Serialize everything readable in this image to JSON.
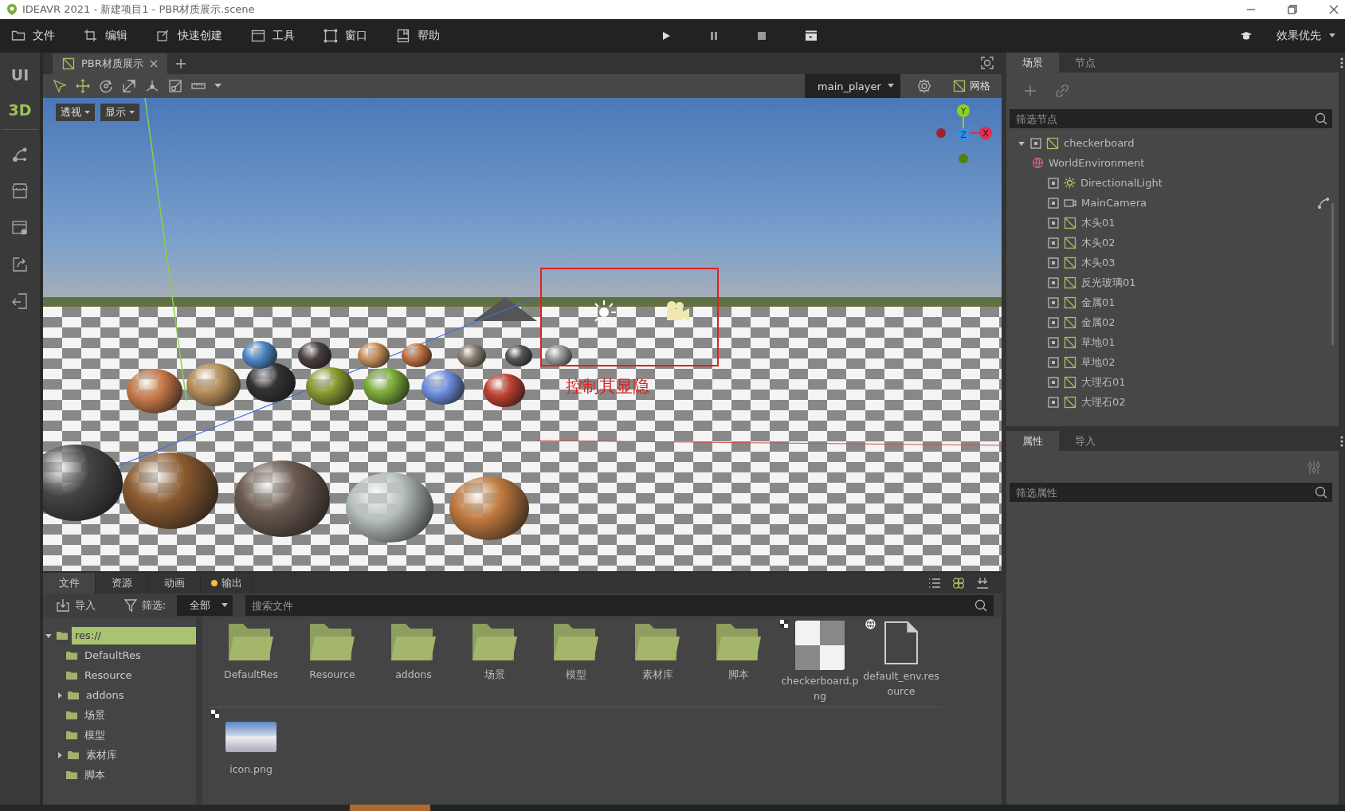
{
  "window": {
    "title": "IDEAVR 2021 - 新建项目1 - PBR材质展示.scene"
  },
  "menu": [
    {
      "label": "文件"
    },
    {
      "label": "编辑"
    },
    {
      "label": "快速创建"
    },
    {
      "label": "工具"
    },
    {
      "label": "窗口"
    },
    {
      "label": "帮助"
    }
  ],
  "quality": {
    "label": "效果优先"
  },
  "side_modes": [
    {
      "label": "UI",
      "selected": false
    },
    {
      "label": "3D",
      "selected": true
    }
  ],
  "editor_tabs": [
    {
      "label": "PBR材质展示",
      "selected": true
    }
  ],
  "viewport": {
    "camera": "main_player",
    "grid_label": "网格",
    "view_buttons": [
      "透视",
      "显示"
    ],
    "axes": {
      "y": "Y",
      "z": "Z",
      "x": "X"
    },
    "annotation": "控制其显隐"
  },
  "scene_panel": {
    "tabs": [
      {
        "label": "场景",
        "selected": true
      },
      {
        "label": "节点",
        "selected": false
      }
    ],
    "filter_placeholder": "筛选节点",
    "tree": [
      {
        "name": "checkerboard",
        "kind": "mesh",
        "expanded": true,
        "children": [
          {
            "name": "WorldEnvironment",
            "kind": "environment"
          },
          {
            "name": "DirectionalLight",
            "kind": "light"
          },
          {
            "name": "MainCamera",
            "kind": "camera"
          },
          {
            "name": "木头01",
            "kind": "mesh"
          },
          {
            "name": "木头02",
            "kind": "mesh"
          },
          {
            "name": "木头03",
            "kind": "mesh"
          },
          {
            "name": "反光玻璃01",
            "kind": "mesh"
          },
          {
            "name": "金属01",
            "kind": "mesh"
          },
          {
            "name": "金属02",
            "kind": "mesh"
          },
          {
            "name": "草地01",
            "kind": "mesh"
          },
          {
            "name": "草地02",
            "kind": "mesh"
          },
          {
            "name": "大理石01",
            "kind": "mesh"
          },
          {
            "name": "大理石02",
            "kind": "mesh"
          }
        ]
      }
    ]
  },
  "inspector": {
    "tabs": [
      {
        "label": "属性",
        "selected": true
      },
      {
        "label": "导入",
        "selected": false
      }
    ],
    "filter_placeholder": "筛选属性"
  },
  "bottom": {
    "tabs": [
      {
        "label": "文件",
        "selected": true,
        "alert": false
      },
      {
        "label": "资源",
        "selected": false,
        "alert": false
      },
      {
        "label": "动画",
        "selected": false,
        "alert": false
      },
      {
        "label": "输出",
        "selected": false,
        "alert": true
      }
    ],
    "import_label": "导入",
    "filter_label": "筛选:",
    "filter_value": "全部",
    "search_placeholder": "搜索文件",
    "tree": [
      {
        "name": "res://",
        "selected": true,
        "expanded": true,
        "children": [
          {
            "name": "DefaultRes",
            "selected": false
          },
          {
            "name": "Resource",
            "selected": false
          },
          {
            "name": "addons",
            "selected": false,
            "expanded": false
          },
          {
            "name": "场景",
            "selected": false
          },
          {
            "name": "模型",
            "selected": false
          },
          {
            "name": "素材库",
            "selected": false,
            "expanded": false
          },
          {
            "name": "脚本",
            "selected": false
          }
        ]
      }
    ],
    "files": [
      {
        "name": "DefaultRes",
        "kind": "folder"
      },
      {
        "name": "Resource",
        "kind": "folder"
      },
      {
        "name": "addons",
        "kind": "folder"
      },
      {
        "name": "场景",
        "kind": "folder"
      },
      {
        "name": "模型",
        "kind": "folder"
      },
      {
        "name": "素材库",
        "kind": "folder"
      },
      {
        "name": "脚本",
        "kind": "folder"
      },
      {
        "name": "checkerboard.png",
        "kind": "texture"
      },
      {
        "name": "default_env.resource",
        "kind": "resource"
      },
      {
        "name": "icon.png",
        "kind": "image"
      }
    ]
  }
}
